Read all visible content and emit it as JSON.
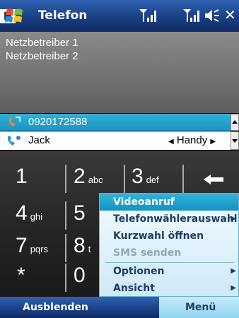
{
  "titlebar": {
    "title": "Telefon"
  },
  "status": {
    "network_badge": "H"
  },
  "operators": [
    "Netzbetreiber 1",
    "Netzbetreiber 2"
  ],
  "call": {
    "number": "0920172588",
    "contact_name": "Jack",
    "contact_type": "Handy"
  },
  "keypad": [
    {
      "num": "1",
      "letters": ""
    },
    {
      "num": "2",
      "letters": "abc"
    },
    {
      "num": "3",
      "letters": "def"
    },
    {
      "num": "4",
      "letters": "ghi"
    },
    {
      "num": "5",
      "letters": ""
    },
    {
      "num": "7",
      "letters": "pqrs"
    },
    {
      "num": "8",
      "letters": "t"
    },
    {
      "num": "*",
      "letters": ""
    },
    {
      "num": "0",
      "letters": ""
    }
  ],
  "menu": {
    "items": [
      {
        "label": "Videoanruf",
        "selected": true,
        "enabled": true,
        "submenu": false
      },
      {
        "label": "Telefonwählerauswahl",
        "selected": false,
        "enabled": true,
        "submenu": true
      },
      {
        "label": "Kurzwahl öffnen",
        "selected": false,
        "enabled": true,
        "submenu": false
      },
      {
        "label": "SMS senden",
        "selected": false,
        "enabled": false,
        "submenu": false
      },
      {
        "label": "Optionen",
        "selected": false,
        "enabled": true,
        "submenu": true
      },
      {
        "label": "Ansicht",
        "selected": false,
        "enabled": true,
        "submenu": true
      }
    ]
  },
  "softkeys": {
    "left": "Ausblenden",
    "right": "Menü"
  },
  "icons": {
    "start": "windows-flag-icon",
    "signal": "signal-strength-icon",
    "volume": "speaker-icon",
    "close": "close-icon",
    "backspace": "backspace-arrow-icon"
  }
}
